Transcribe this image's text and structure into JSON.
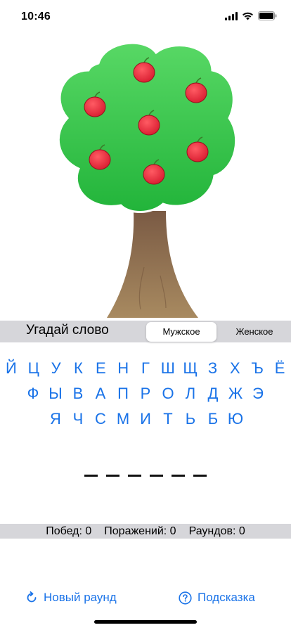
{
  "status": {
    "time": "10:46"
  },
  "toolbar": {
    "title": "Угадай слово",
    "segments": [
      "Мужское",
      "Женское"
    ]
  },
  "keyboard": {
    "rows": [
      [
        "Й",
        "Ц",
        "У",
        "К",
        "Е",
        "Н",
        "Г",
        "Ш",
        "Щ",
        "З",
        "Х",
        "Ъ",
        "Ё"
      ],
      [
        "Ф",
        "Ы",
        "В",
        "А",
        "П",
        "Р",
        "О",
        "Л",
        "Д",
        "Ж",
        "Э"
      ],
      [
        "Я",
        "Ч",
        "С",
        "М",
        "И",
        "Т",
        "Ь",
        "Б",
        "Ю"
      ]
    ]
  },
  "word": {
    "letters": [
      "_",
      "_",
      "_",
      "_",
      "_",
      "_"
    ]
  },
  "stats": {
    "wins": "Побед: 0",
    "losses": "Поражений: 0",
    "rounds": "Раундов: 0"
  },
  "actions": {
    "new_round": "Новый раунд",
    "hint": "Подсказка"
  },
  "colors": {
    "accent": "#1a73e8",
    "foliage": "#3cc84a",
    "trunk": "#8d6b4a",
    "apple": "#e8283b",
    "bar": "#d6d6da"
  },
  "tree": {
    "apples": 7
  }
}
